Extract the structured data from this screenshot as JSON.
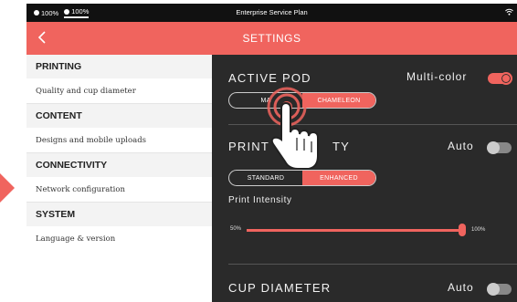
{
  "status_bar": {
    "battery_1": "100%",
    "battery_2": "100%",
    "title": "Enterprise Service Plan",
    "wifi_icon": "wifi-icon"
  },
  "header": {
    "back_icon": "chevron-left-icon",
    "title": "SETTINGS"
  },
  "menu": {
    "sections": [
      {
        "header": "PRINTING",
        "item": "Quality and cup diameter"
      },
      {
        "header": "CONTENT",
        "item": "Designs and mobile uploads"
      },
      {
        "header": "CONNECTIVITY",
        "item": "Network configuration"
      },
      {
        "header": "SYSTEM",
        "item": "Language & version"
      }
    ]
  },
  "panel": {
    "active_pod": {
      "label": "ACTIVE POD",
      "right_label": "Multi-color",
      "toggle_on": true,
      "options": [
        "MA",
        "CHAMELEON"
      ],
      "selected": 1
    },
    "print_quality": {
      "label_left": "PRINT",
      "label_right": "TY",
      "right_label": "Auto",
      "toggle_on": false,
      "options": [
        "STANDARD",
        "ENHANCED"
      ],
      "selected": 1
    },
    "intensity": {
      "label": "Print Intensity",
      "min": "50%",
      "max": "100%",
      "value_percent": 100
    },
    "cup_diameter": {
      "label": "CUP DIAMETER",
      "right_label": "Auto",
      "toggle_on": false
    }
  },
  "colors": {
    "accent": "#f0645e",
    "panel_bg": "#2a2a2a",
    "menu_header_bg": "#f3f3f3"
  }
}
